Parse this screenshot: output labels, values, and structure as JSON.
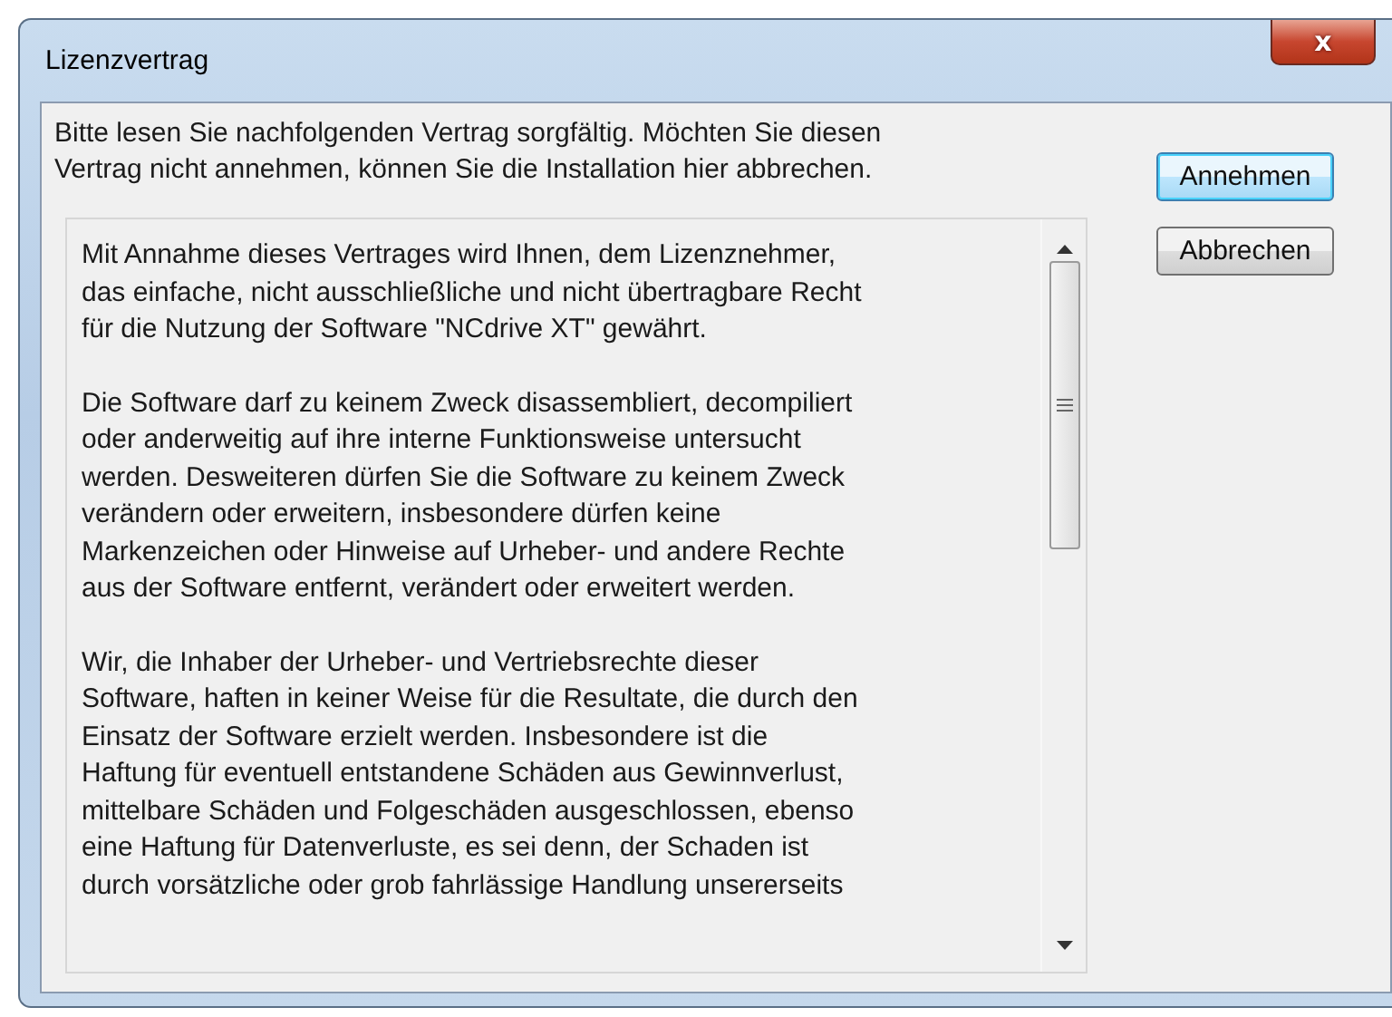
{
  "window": {
    "title": "Lizenzvertrag",
    "close": "x"
  },
  "intro": "Bitte lesen Sie nachfolgenden Vertrag sorgfältig. Möchten Sie diesen\nVertrag nicht annehmen, können Sie die Installation hier abbrechen.",
  "buttons": [
    {
      "label": "Annehmen",
      "default": true
    },
    {
      "label": "Abbrechen",
      "default": false
    }
  ],
  "license_paragraphs": [
    "Mit Annahme dieses Vertrages wird Ihnen, dem Lizenznehmer,\ndas einfache, nicht ausschließliche und nicht übertragbare Recht\nfür die Nutzung der Software \"NCdrive XT\" gewährt.",
    "Die Software darf zu keinem Zweck disassembliert, decompiliert\noder anderweitig auf ihre interne Funktionsweise untersucht\nwerden. Desweiteren dürfen Sie die Software zu keinem Zweck\nverändern oder erweitern, insbesondere dürfen keine\nMarkenzeichen oder Hinweise auf Urheber- und andere Rechte\naus der Software entfernt, verändert oder erweitert werden.",
    "Wir, die Inhaber der Urheber- und Vertriebsrechte dieser\nSoftware, haften in keiner Weise für die Resultate, die durch den\nEinsatz der Software erzielt werden. Insbesondere ist die\nHaftung für eventuell entstandene Schäden aus Gewinnverlust,\nmittelbare Schäden und Folgeschäden ausgeschlossen, ebenso\neine Haftung für Datenverluste, es sei denn, der Schaden ist\ndurch vorsätzliche oder grob fahrlässige Handlung unsererseits"
  ]
}
